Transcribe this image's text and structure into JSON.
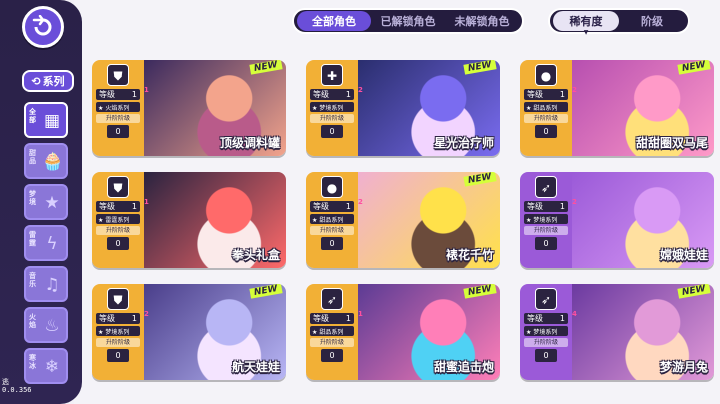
{
  "header": {
    "back_icon": "back-arrow-icon",
    "tabs": [
      {
        "label": "全部角色",
        "active": true
      },
      {
        "label": "已解锁角色",
        "active": false
      },
      {
        "label": "未解锁角色",
        "active": false
      }
    ],
    "sort": [
      {
        "label": "稀有度",
        "active": true
      },
      {
        "label": "阶级",
        "active": false
      }
    ]
  },
  "sidebar": {
    "title": "系列",
    "items": [
      {
        "label": "全部",
        "icon": "grid-icon",
        "active": true
      },
      {
        "label": "甜品",
        "icon": "cupcake-icon",
        "active": false
      },
      {
        "label": "梦境",
        "icon": "star-icon",
        "active": false
      },
      {
        "label": "雷霆",
        "icon": "lightning-icon",
        "active": false
      },
      {
        "label": "音乐",
        "icon": "music-note-icon",
        "active": false
      },
      {
        "label": "火焰",
        "icon": "flame-icon",
        "active": false
      },
      {
        "label": "寒冰",
        "icon": "snowflake-icon",
        "active": false
      }
    ],
    "version_lines": [
      "逃",
      "0.0.356"
    ]
  },
  "common": {
    "level_label": "等级",
    "stage_label": "升阶阶级"
  },
  "cards": [
    {
      "name": "顶级调料罐",
      "level": "1",
      "series": "火焰系列",
      "stage": "0",
      "color": "orange",
      "icon": "shield-icon",
      "new": true,
      "stars": "1",
      "art": [
        "#f3a48c",
        "#b95b8a",
        "#3b2a5e"
      ]
    },
    {
      "name": "星光治疗师",
      "level": "1",
      "series": "梦境系列",
      "stage": "0",
      "color": "orange",
      "icon": "medkit-icon",
      "new": true,
      "stars": "2",
      "art": [
        "#7a6cf0",
        "#f2d4ff",
        "#2a2e6e"
      ]
    },
    {
      "name": "甜甜圈双马尾",
      "level": "1",
      "series": "甜品系列",
      "stage": "0",
      "color": "orange",
      "icon": "bomb-icon",
      "new": true,
      "stars": "2",
      "art": [
        "#ff9ac8",
        "#ffe07a",
        "#b74fb0"
      ]
    },
    {
      "name": "拳头礼盒",
      "level": "1",
      "series": "雷霆系列",
      "stage": "0",
      "color": "orange",
      "icon": "shield-icon",
      "new": false,
      "stars": "1",
      "art": [
        "#ff6a6a",
        "#fbeaea",
        "#2a2340"
      ]
    },
    {
      "name": "裱花千竹",
      "level": "1",
      "series": "甜品系列",
      "stage": "0",
      "color": "orange",
      "icon": "bomb-icon",
      "new": true,
      "stars": "2",
      "art": [
        "#ffe14a",
        "#6b4b3b",
        "#f0b0d0"
      ]
    },
    {
      "name": "嫦娥娃娃",
      "level": "1",
      "series": "梦境系列",
      "stage": "0",
      "color": "purple",
      "icon": "bow-icon",
      "new": false,
      "stars": "2",
      "art": [
        "#d99af5",
        "#ffe0a0",
        "#9b5ad8"
      ]
    },
    {
      "name": "航天娃娃",
      "level": "1",
      "series": "梦境系列",
      "stage": "0",
      "color": "orange",
      "icon": "shield-icon",
      "new": true,
      "stars": "2",
      "art": [
        "#b8b6f5",
        "#f4e4ff",
        "#4a3e8a"
      ]
    },
    {
      "name": "甜蜜追击炮",
      "level": "1",
      "series": "甜品系列",
      "stage": "0",
      "color": "orange",
      "icon": "bow-icon",
      "new": true,
      "stars": "1",
      "art": [
        "#ff7fb8",
        "#4fd1f4",
        "#5c3b94"
      ]
    },
    {
      "name": "梦游月兔",
      "level": "1",
      "series": "梦境系列",
      "stage": "0",
      "color": "purple",
      "icon": "bow-icon",
      "new": true,
      "stars": "4",
      "art": [
        "#e29ad8",
        "#ffd8c0",
        "#6b3aa0"
      ]
    }
  ],
  "new_badge": "NEW"
}
